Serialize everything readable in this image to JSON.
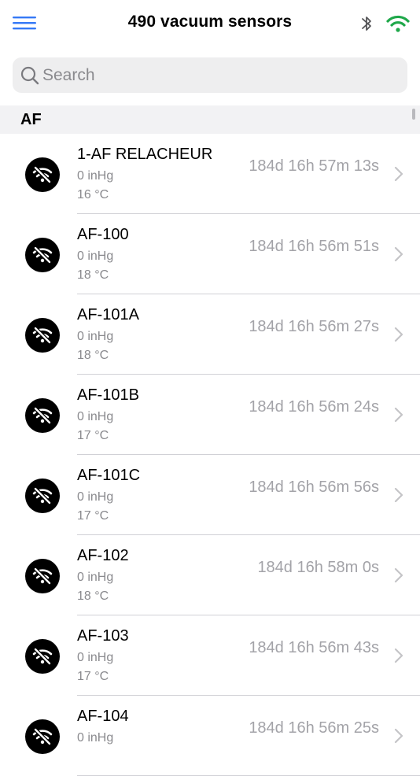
{
  "navbar": {
    "title": "490 vacuum sensors",
    "menu_icon": "hamburger-menu-icon",
    "bluetooth_icon": "bluetooth-icon",
    "wifi_icon": "wifi-icon",
    "wifi_color": "#1fa84a",
    "accent_color": "#3478f6"
  },
  "search": {
    "placeholder": "Search",
    "value": ""
  },
  "section": {
    "title": "AF"
  },
  "rows": [
    {
      "name": "1-AF RELACHEUR",
      "pressure": "0 inHg",
      "temperature": "16 °C",
      "elapsed": "184d 16h 57m 13s",
      "status_icon": "wifi-off-icon"
    },
    {
      "name": "AF-100",
      "pressure": "0 inHg",
      "temperature": "18 °C",
      "elapsed": "184d 16h 56m 51s",
      "status_icon": "wifi-off-icon"
    },
    {
      "name": "AF-101A",
      "pressure": "0 inHg",
      "temperature": "18 °C",
      "elapsed": "184d 16h 56m 27s",
      "status_icon": "wifi-off-icon"
    },
    {
      "name": "AF-101B",
      "pressure": "0 inHg",
      "temperature": "17 °C",
      "elapsed": "184d 16h 56m 24s",
      "status_icon": "wifi-off-icon"
    },
    {
      "name": "AF-101C",
      "pressure": "0 inHg",
      "temperature": "17 °C",
      "elapsed": "184d 16h 56m 56s",
      "status_icon": "wifi-off-icon"
    },
    {
      "name": "AF-102",
      "pressure": "0 inHg",
      "temperature": "18 °C",
      "elapsed": "184d 16h 58m 0s",
      "status_icon": "wifi-off-icon"
    },
    {
      "name": "AF-103",
      "pressure": "0 inHg",
      "temperature": "17 °C",
      "elapsed": "184d 16h 56m 43s",
      "status_icon": "wifi-off-icon"
    },
    {
      "name": "AF-104",
      "pressure": "0 inHg",
      "temperature": "",
      "elapsed": "184d 16h 56m 25s",
      "status_icon": "wifi-off-icon"
    }
  ]
}
